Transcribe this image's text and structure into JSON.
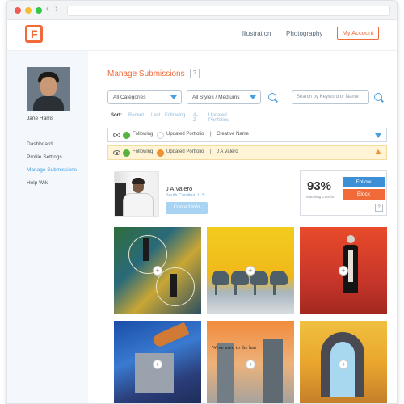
{
  "header": {
    "nav_illustration": "Illustration",
    "nav_photography": "Photography",
    "my_account": "My Account",
    "logo_letter": "F"
  },
  "sidebar": {
    "username": "Jane Harris",
    "items": [
      {
        "label": "Dashboard"
      },
      {
        "label": "Profile Settings"
      },
      {
        "label": "Manage Submissions"
      },
      {
        "label": "Help Wiki"
      }
    ]
  },
  "main": {
    "title": "Manage Submissions",
    "help": "?",
    "category_select": "All Categories",
    "style_select": "All Styles / Mediums",
    "search_placeholder": "Search by Keyword or Name",
    "sort": {
      "label": "Sort:",
      "options": [
        "Recent",
        "Last",
        "Following",
        "A-Z",
        "Updated Portfolios"
      ]
    },
    "filter_rows": [
      {
        "following": "Following",
        "portfolio": "Updated Portfolio",
        "sep": "|",
        "value": "Creative Name",
        "dot_color": "#56b33f"
      },
      {
        "following": "Following",
        "portfolio": "Updated Portfolio",
        "sep": "|",
        "value": "J A Valero",
        "dot_color": "#f09230"
      }
    ],
    "artist": {
      "name": "J A Valero",
      "location": "South Carolina, U.S.",
      "contact": "Contact Info",
      "match_percent": "93%",
      "match_label": "Matching Criteria",
      "follow": "Follow",
      "block": "Block",
      "help": "?"
    },
    "gallery": {
      "plus_symbol": "+",
      "caption_tile5": "Weve used to the last"
    }
  },
  "colors": {
    "accent_orange": "#f06a3a",
    "accent_blue": "#3d8fd6"
  }
}
